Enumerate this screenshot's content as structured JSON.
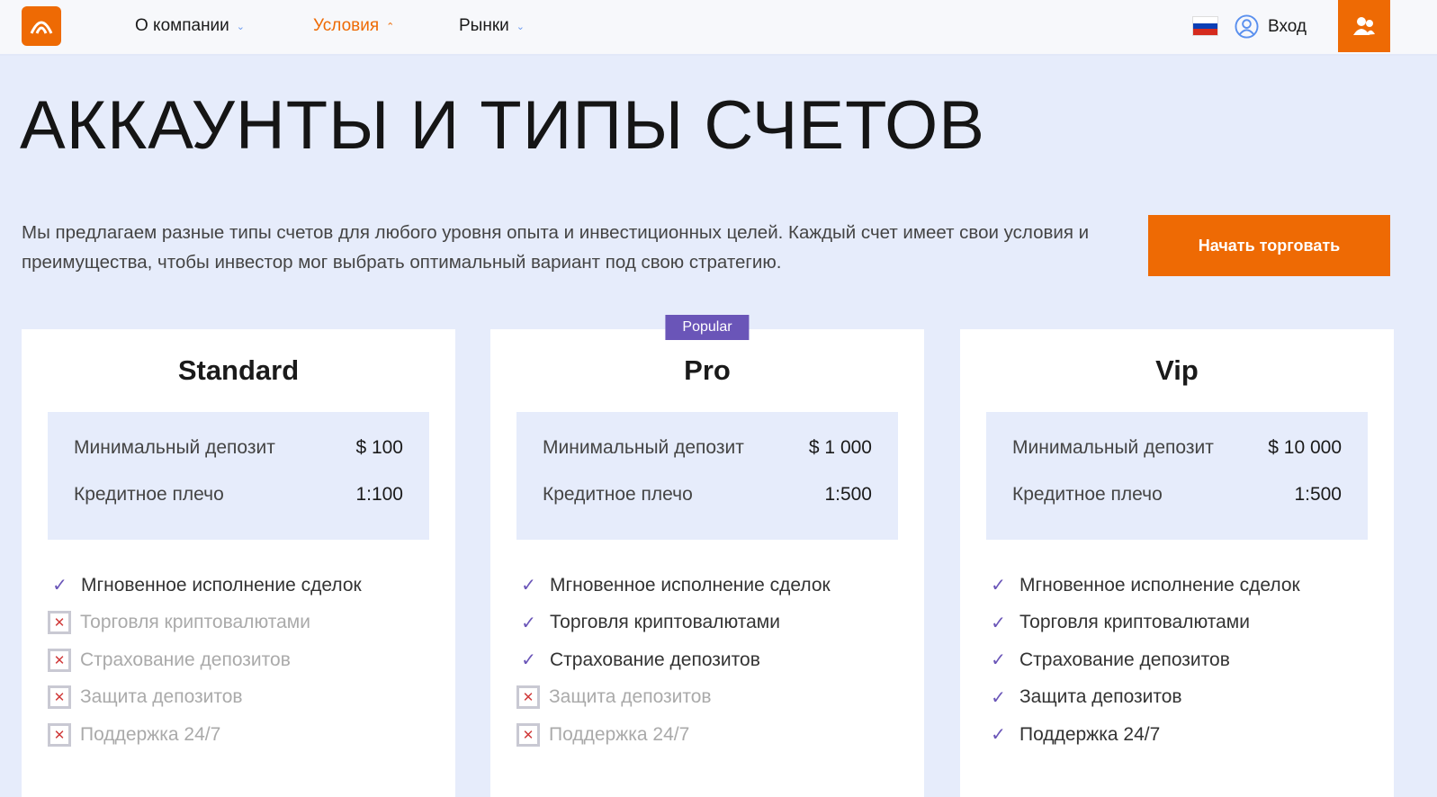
{
  "header": {
    "nav": [
      {
        "label": "О компании",
        "chevron": "down"
      },
      {
        "label": "Условия",
        "chevron": "up",
        "active": true
      },
      {
        "label": "Рынки",
        "chevron": "down"
      }
    ],
    "login": "Вход",
    "accent": "#ee6a04"
  },
  "hero": {
    "title": "АККАУНТЫ И ТИПЫ СЧЕТОВ",
    "intro": "Мы предлагаем разные типы счетов для любого уровня опыта и инвестиционных целей. Каждый счет имеет свои условия и преимущества, чтобы инвестор мог выбрать оптимальный вариант под свою стратегию.",
    "cta": "Начать торговать"
  },
  "plans": [
    {
      "name": "Standard",
      "deposit_label": "Минимальный депозит",
      "deposit": "$ 100",
      "leverage_label": "Кредитное плечо",
      "leverage": "1:100",
      "features": [
        {
          "label": "Мгновенное исполнение сделок",
          "on": true
        },
        {
          "label": "Торговля криптовалютами",
          "on": false
        },
        {
          "label": "Страхование депозитов",
          "on": false
        },
        {
          "label": "Защита депозитов",
          "on": false
        },
        {
          "label": "Поддержка 24/7",
          "on": false
        }
      ]
    },
    {
      "name": "Pro",
      "badge": "Popular",
      "deposit_label": "Минимальный депозит",
      "deposit": "$ 1 000",
      "leverage_label": "Кредитное плечо",
      "leverage": "1:500",
      "features": [
        {
          "label": "Мгновенное исполнение сделок",
          "on": true
        },
        {
          "label": "Торговля криптовалютами",
          "on": true
        },
        {
          "label": "Страхование депозитов",
          "on": true
        },
        {
          "label": "Защита депозитов",
          "on": false
        },
        {
          "label": "Поддержка 24/7",
          "on": false
        }
      ]
    },
    {
      "name": "Vip",
      "deposit_label": "Минимальный депозит",
      "deposit": "$ 10 000",
      "leverage_label": "Кредитное плечо",
      "leverage": "1:500",
      "features": [
        {
          "label": "Мгновенное исполнение сделок",
          "on": true
        },
        {
          "label": "Торговля криптовалютами",
          "on": true
        },
        {
          "label": "Страхование депозитов",
          "on": true
        },
        {
          "label": "Защита депозитов",
          "on": true
        },
        {
          "label": "Поддержка 24/7",
          "on": true
        }
      ]
    }
  ]
}
